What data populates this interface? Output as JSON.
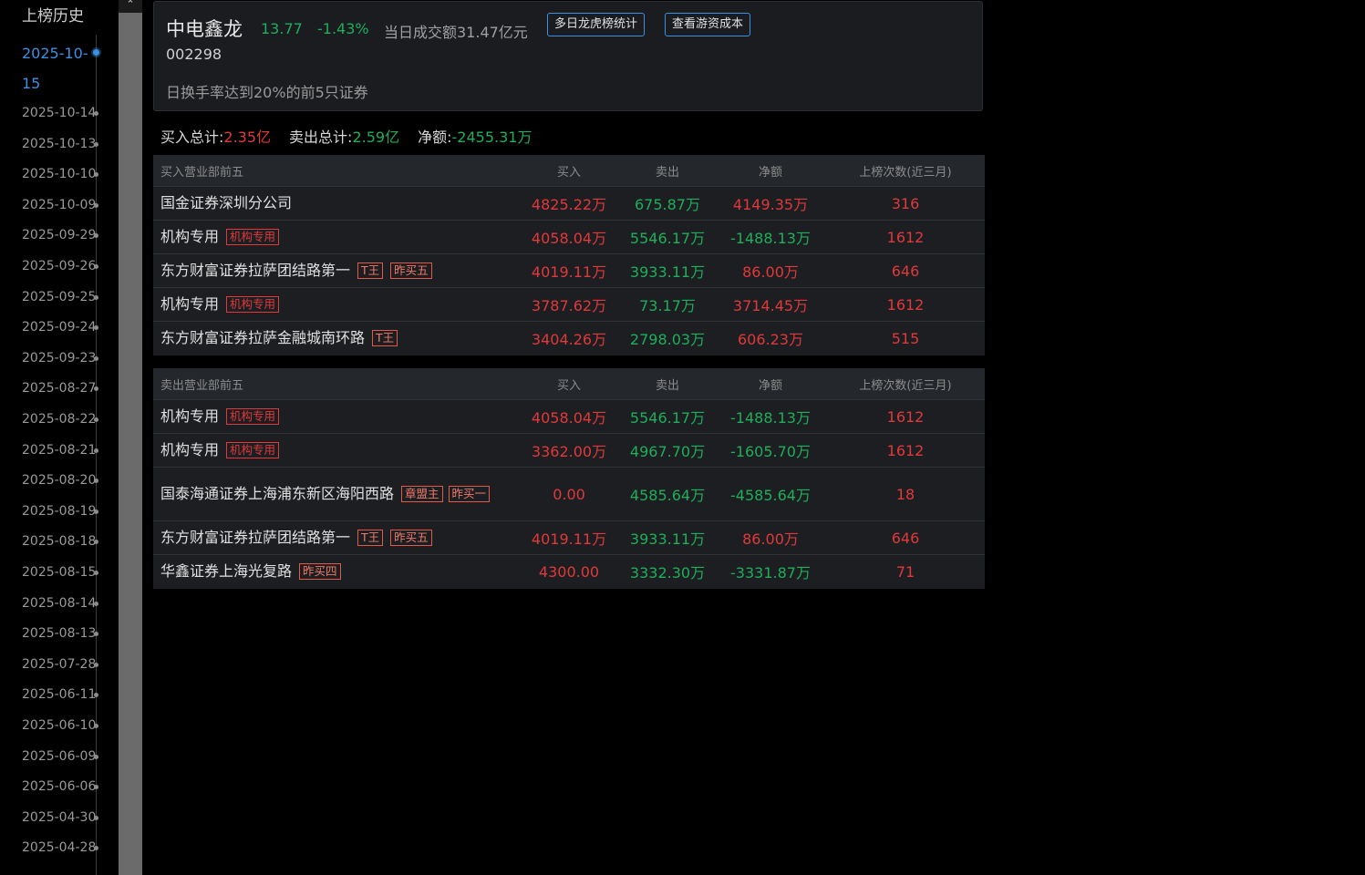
{
  "sidebar": {
    "title": "上榜历史",
    "dates": [
      "2025-10-15",
      "2025-10-14",
      "2025-10-13",
      "2025-10-10",
      "2025-10-09",
      "2025-09-29",
      "2025-09-26",
      "2025-09-25",
      "2025-09-24",
      "2025-09-23",
      "2025-08-27",
      "2025-08-22",
      "2025-08-21",
      "2025-08-20",
      "2025-08-19",
      "2025-08-18",
      "2025-08-15",
      "2025-08-14",
      "2025-08-13",
      "2025-07-28",
      "2025-06-11",
      "2025-06-10",
      "2025-06-09",
      "2025-06-06",
      "2025-04-30",
      "2025-04-28"
    ],
    "active_date_line1": "2025-10-",
    "active_date_line2": "15"
  },
  "scrollbar": {
    "up_arrow": "⌃"
  },
  "header": {
    "stock_name": "中电鑫龙",
    "price": "13.77",
    "change_pct": "-1.43%",
    "turnover": "当日成交额31.47亿元",
    "btn_multi_day": "多日龙虎榜统计",
    "btn_cost": "查看游资成本",
    "stock_code": "002298",
    "reason": "日换手率达到20%的前5只证券"
  },
  "summary": {
    "buy_label": "买入总计:",
    "buy_value": "2.35亿",
    "sell_label": "卖出总计:",
    "sell_value": "2.59亿",
    "net_label": "净额:",
    "net_value": "-2455.31万"
  },
  "buy_table": {
    "headers": [
      "买入营业部前五",
      "买入",
      "卖出",
      "净额",
      "上榜次数(近三月)"
    ],
    "rows": [
      {
        "name": "国金证券深圳分公司",
        "tags": [],
        "buy": "4825.22万",
        "sell": "675.87万",
        "net": "4149.35万",
        "count": "316"
      },
      {
        "name": "机构专用",
        "tags": [
          "机构专用"
        ],
        "buy": "4058.04万",
        "sell": "5546.17万",
        "net": "-1488.13万",
        "count": "1612"
      },
      {
        "name": "东方财富证券拉萨团结路第一",
        "tags": [
          "T王",
          "昨买五"
        ],
        "buy": "4019.11万",
        "sell": "3933.11万",
        "net": "86.00万",
        "count": "646"
      },
      {
        "name": "机构专用",
        "tags": [
          "机构专用"
        ],
        "buy": "3787.62万",
        "sell": "73.17万",
        "net": "3714.45万",
        "count": "1612"
      },
      {
        "name": "东方财富证券拉萨金融城南环路",
        "tags": [
          "T王"
        ],
        "buy": "3404.26万",
        "sell": "2798.03万",
        "net": "606.23万",
        "count": "515"
      }
    ]
  },
  "sell_table": {
    "headers": [
      "卖出营业部前五",
      "买入",
      "卖出",
      "净额",
      "上榜次数(近三月)"
    ],
    "rows": [
      {
        "name": "机构专用",
        "tags": [
          "机构专用"
        ],
        "buy": "4058.04万",
        "sell": "5546.17万",
        "net": "-1488.13万",
        "count": "1612"
      },
      {
        "name": "机构专用",
        "tags": [
          "机构专用"
        ],
        "buy": "3362.00万",
        "sell": "4967.70万",
        "net": "-1605.70万",
        "count": "1612"
      },
      {
        "name": "国泰海通证券上海浦东新区海阳西路",
        "tags": [
          "章盟主",
          "昨买一"
        ],
        "buy": "0.00",
        "sell": "4585.64万",
        "net": "-4585.64万",
        "count": "18"
      },
      {
        "name": "东方财富证券拉萨团结路第一",
        "tags": [
          "T王",
          "昨买五"
        ],
        "buy": "4019.11万",
        "sell": "3933.11万",
        "net": "86.00万",
        "count": "646"
      },
      {
        "name": "华鑫证券上海光复路",
        "tags": [
          "昨买四"
        ],
        "buy": "4300.00",
        "sell": "3332.30万",
        "net": "-3331.87万",
        "count": "71"
      }
    ]
  },
  "colors": {
    "up": "#e0393b",
    "down": "#1fae5a",
    "accent": "#3d8fe3"
  }
}
